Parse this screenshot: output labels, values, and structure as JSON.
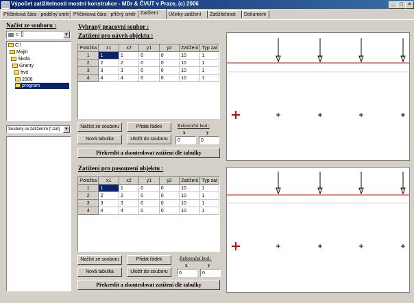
{
  "window": {
    "title": "Výpočet zatížitelnosti mostní konstrukce  - MDr & ČVUT v Praze, (c) 2006",
    "controls": [
      "_",
      "□",
      "×"
    ]
  },
  "tabs": [
    {
      "label": "Příčinková čára - podélný směr"
    },
    {
      "label": "Příčinková čára - příčný směr"
    },
    {
      "label": "Zatížení"
    },
    {
      "label": "Účinky zatížení"
    },
    {
      "label": "Zatížitelnost"
    },
    {
      "label": "Dokument"
    }
  ],
  "left": {
    "heading": "Načíst ze souboru :",
    "drive": "c: []",
    "tree": [
      "C:\\",
      "Majkl",
      "Škola",
      "Granty",
      "frvš",
      "2006",
      "program"
    ],
    "filter": "Soubory se zatížením [*.zat]"
  },
  "right": {
    "heading": "Vybraný pracovní soubor :",
    "section1": {
      "heading": "Zatížení pro návrh objektu :",
      "columns": [
        "Položka",
        "x1",
        "x2",
        "y1",
        "y2",
        "Zatížení",
        "Typ zat"
      ],
      "rows": [
        [
          "1",
          "1",
          "1",
          "0",
          "0",
          "10",
          "1"
        ],
        [
          "2",
          "2",
          "2",
          "0",
          "0",
          "10",
          "1"
        ],
        [
          "3",
          "3",
          "3",
          "0",
          "0",
          "10",
          "1"
        ],
        [
          "4",
          "4",
          "4",
          "0",
          "0",
          "10",
          "1"
        ]
      ],
      "btn_load": "Načíst ze souboru",
      "btn_add": "Přidat řádek",
      "btn_new": "Nová tabulka",
      "btn_save": "Uložit do souboru",
      "ref_label": "Referenční bod :",
      "x_label": "x",
      "y_label": "y",
      "x_value": "0",
      "y_value": "0",
      "btn_redraw": "Překreslit a zkontrolovat zatížení dle tabulky"
    },
    "section2": {
      "heading": "Zatížení pro posouzení objektu :",
      "columns": [
        "Položka",
        "x1",
        "x2",
        "y1",
        "y2",
        "Zatížení",
        "Typ zat"
      ],
      "rows": [
        [
          "1",
          "1",
          "1",
          "0",
          "0",
          "10",
          "1"
        ],
        [
          "2",
          "2",
          "2",
          "0",
          "0",
          "10",
          "1"
        ],
        [
          "3",
          "3",
          "3",
          "0",
          "0",
          "10",
          "1"
        ],
        [
          "4",
          "4",
          "4",
          "0",
          "0",
          "10",
          "1"
        ]
      ],
      "btn_load": "Načíst ze souboru",
      "btn_add": "Přidat řádek",
      "btn_new": "Nová tabulka",
      "btn_save": "Uložit do souboru",
      "ref_label": "Referenční bod :",
      "x_label": "x",
      "y_label": "y",
      "x_value": "0",
      "y_value": "0",
      "btn_redraw": "Překreslit a zkontrolovat zatížení dle tabulky"
    }
  },
  "colors": {
    "titlebar": "#0a246a",
    "selection": "#0a246a",
    "accent_red": "#e00000"
  }
}
